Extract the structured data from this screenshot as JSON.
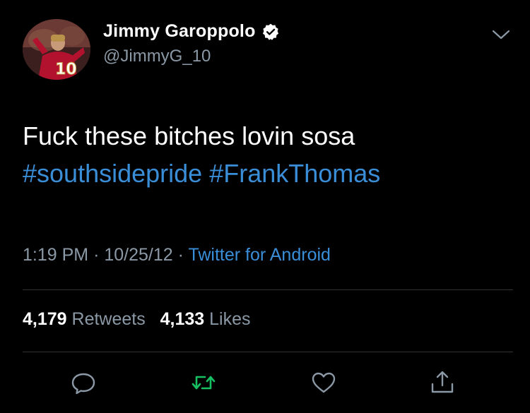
{
  "tweet": {
    "author_name": "Jimmy Garoppolo",
    "author_handle": "@JimmyG_10",
    "text": "Fuck these bitches lovin sosa",
    "hashtags": [
      "#southsidepride",
      "#FrankThomas"
    ],
    "time": "1:19 PM",
    "date": "10/25/12",
    "source": "Twitter for Android",
    "retweets": "4,179",
    "retweets_label": "Retweets",
    "likes": "4,133",
    "likes_label": "Likes"
  },
  "icons": {
    "verified": "verified-badge-icon",
    "more": "chevron-down-icon",
    "reply": "reply-icon",
    "retweet": "retweet-icon",
    "like": "heart-icon",
    "share": "share-icon"
  },
  "colors": {
    "background": "#000000",
    "text_primary": "#ffffff",
    "text_secondary": "#8b98a5",
    "link": "#3a8ed8",
    "retweet_active": "#17bf63",
    "divider": "#2f3336"
  }
}
